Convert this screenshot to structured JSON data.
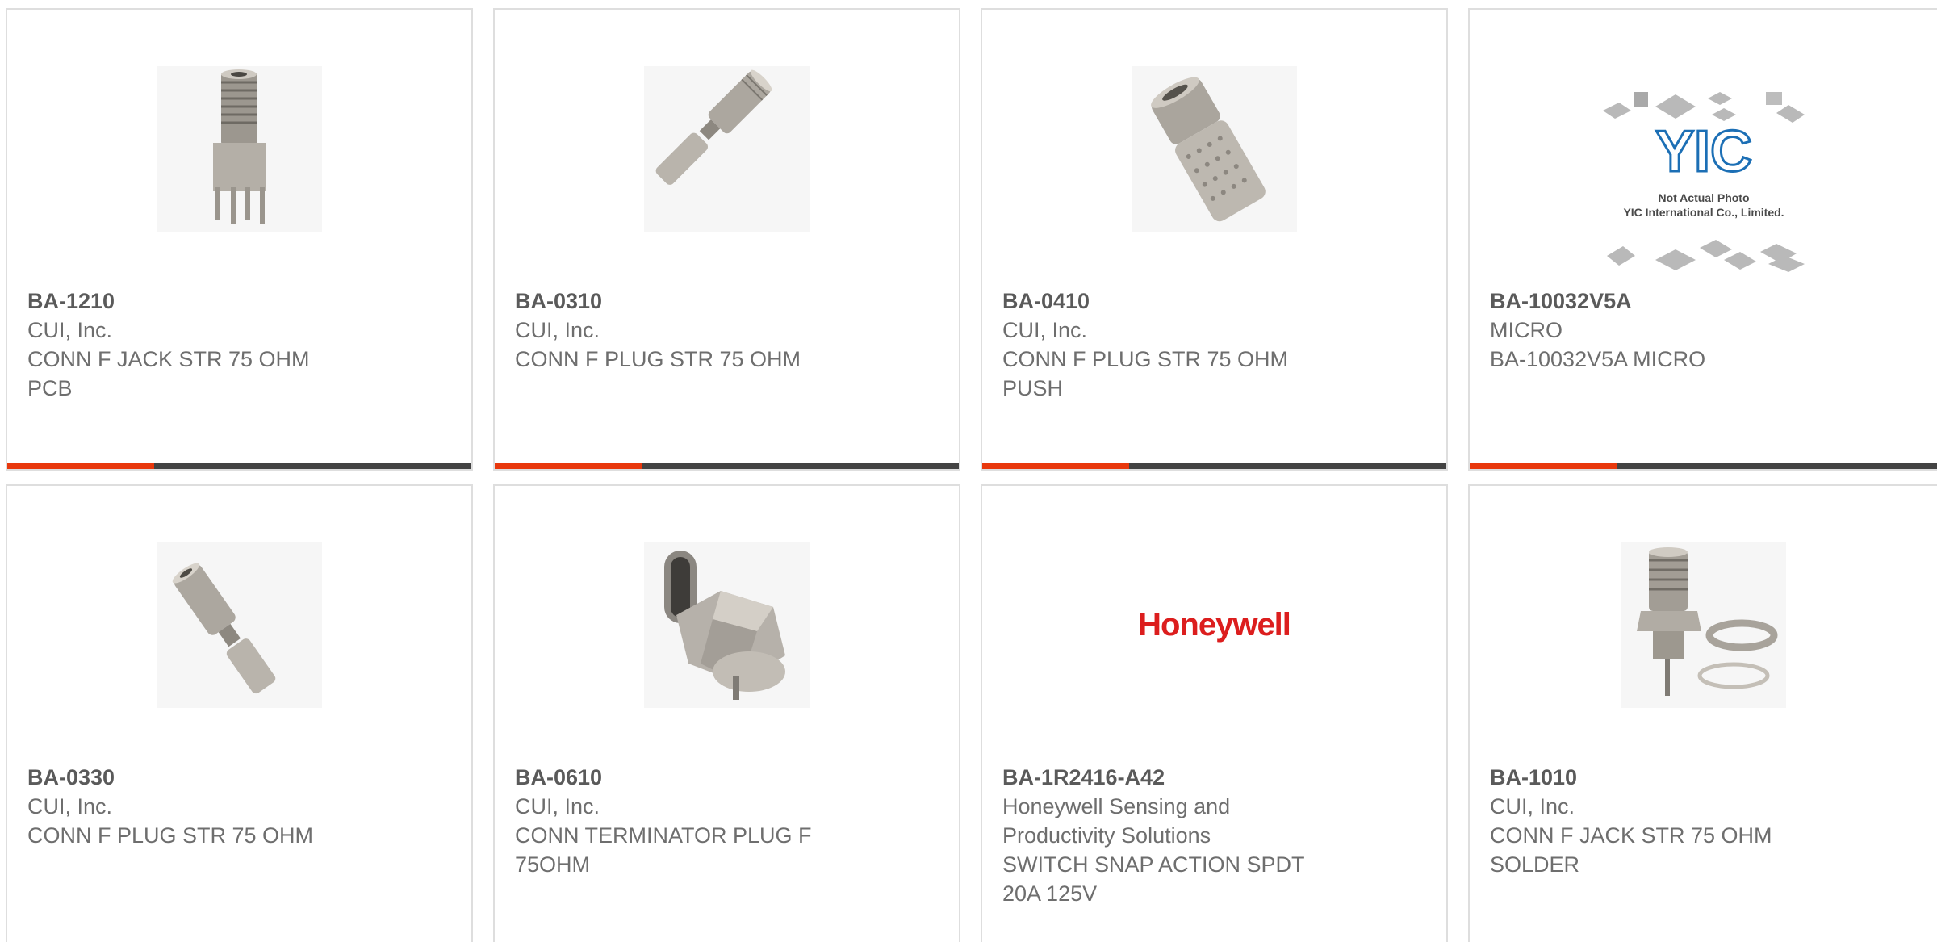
{
  "products": [
    {
      "part_number": "BA-1210",
      "manufacturer": "CUI, Inc.",
      "description": "CONN F JACK STR 75 OHM PCB",
      "image_icon": "f-jack-pcb-connector-photo"
    },
    {
      "part_number": "BA-0310",
      "manufacturer": "CUI, Inc.",
      "description": "CONN F PLUG STR 75 OHM",
      "image_icon": "f-plug-crimp-connector-photo"
    },
    {
      "part_number": "BA-0410",
      "manufacturer": "CUI, Inc.",
      "description": "CONN F PLUG STR 75 OHM PUSH",
      "image_icon": "f-plug-knurled-connector-photo"
    },
    {
      "part_number": "BA-10032V5A",
      "manufacturer": "MICRO",
      "description": "BA-10032V5A MICRO",
      "image_icon": "yic-placeholder-photo",
      "placeholder_logo": "YIC",
      "placeholder_line1": "Not Actual Photo",
      "placeholder_line2": "YIC International Co., Limited."
    },
    {
      "part_number": "BA-0330",
      "manufacturer": "CUI, Inc.",
      "description": "CONN F PLUG STR 75 OHM",
      "image_icon": "f-plug-crimp-connector-photo"
    },
    {
      "part_number": "BA-0610",
      "manufacturer": "CUI, Inc.",
      "description": "CONN TERMINATOR PLUG F 75OHM",
      "image_icon": "f-terminator-plug-photo"
    },
    {
      "part_number": "BA-1R2416-A42",
      "manufacturer": "Honeywell Sensing and Productivity Solutions",
      "description": "SWITCH SNAP ACTION SPDT 20A 125V",
      "image_icon": "honeywell-logo",
      "logo_text": "Honeywell"
    },
    {
      "part_number": "BA-1010",
      "manufacturer": "CUI, Inc.",
      "description": "CONN F JACK STR 75 OHM SOLDER",
      "image_icon": "f-jack-bulkhead-connector-photo"
    }
  ],
  "colors": {
    "accent_bar": "#e8380d",
    "dark_bar": "#434343",
    "card_border": "#dedede",
    "part_number_text": "#5a5a5a",
    "body_text": "#6e6e6e",
    "honeywell_red": "#dc1e1e"
  }
}
